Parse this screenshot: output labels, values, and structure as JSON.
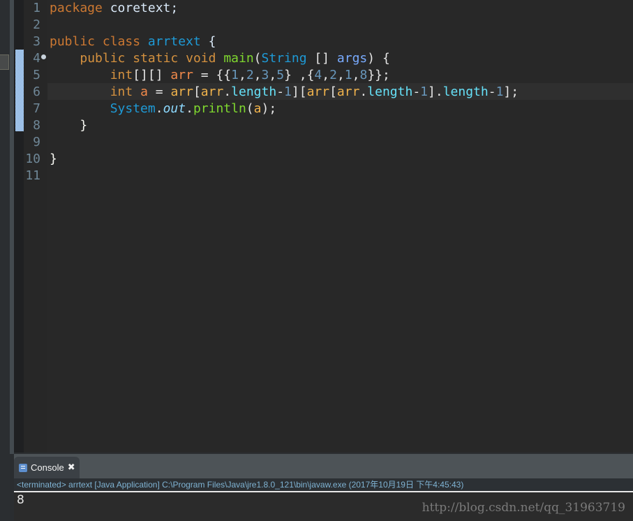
{
  "editor": {
    "line_numbers": [
      "1",
      "2",
      "3",
      "4",
      "5",
      "6",
      "7",
      "8",
      "9",
      "10",
      "11"
    ],
    "lines": {
      "l1": {
        "kw": "package",
        "name": "coretext",
        "semi": ";"
      },
      "l3": {
        "kw1": "public",
        "kw2": "class",
        "cls": "arrtext",
        "brace": "{"
      },
      "l4": {
        "kw1": "public",
        "kw2": "static",
        "kw3": "void",
        "method": "main",
        "open": "(",
        "type": "String",
        "arr": "[]",
        "param": "args",
        "close": ")",
        "brace": "{"
      },
      "l5": {
        "type": "int",
        "dims": "[][]",
        "var": "arr",
        "eq": "=",
        "o1": "{{",
        "a1": "1",
        "a2": "2",
        "a3": "3",
        "a4": "5",
        "c1": "}",
        "sep": " ,{",
        "b1": "4",
        "b2": "2",
        "b3": "1",
        "b4": "8",
        "end": "}};"
      },
      "l6": {
        "type": "int",
        "var": "a",
        "eq": "=",
        "arr1": "arr",
        "br1": "[",
        "arr2": "arr",
        "dot1": ".",
        "len1": "length",
        "m1": "-",
        "n1": "1",
        "br2": "][",
        "arr3": "arr",
        "br3": "[",
        "arr4": "arr",
        "dot2": ".",
        "len2": "length",
        "m2": "-",
        "n2": "1",
        "br4": "].",
        "len3": "length",
        "m3": "-",
        "n3": "1",
        "end": "];"
      },
      "l7": {
        "cls": "System",
        "dot1": ".",
        "field": "out",
        "dot2": ".",
        "method": "println",
        "open": "(",
        "arg": "a",
        "end": ");"
      },
      "l8": {
        "brace": "}"
      },
      "l10": {
        "brace": "}"
      }
    }
  },
  "console": {
    "tab_label": "Console",
    "close_symbol": "✖",
    "status": "<terminated> arrtext [Java Application] C:\\Program Files\\Java\\jre1.8.0_121\\bin\\javaw.exe (2017年10月19日 下午4:45:43)",
    "output": "8"
  },
  "watermark": "http://blog.csdn.net/qq_31963719"
}
